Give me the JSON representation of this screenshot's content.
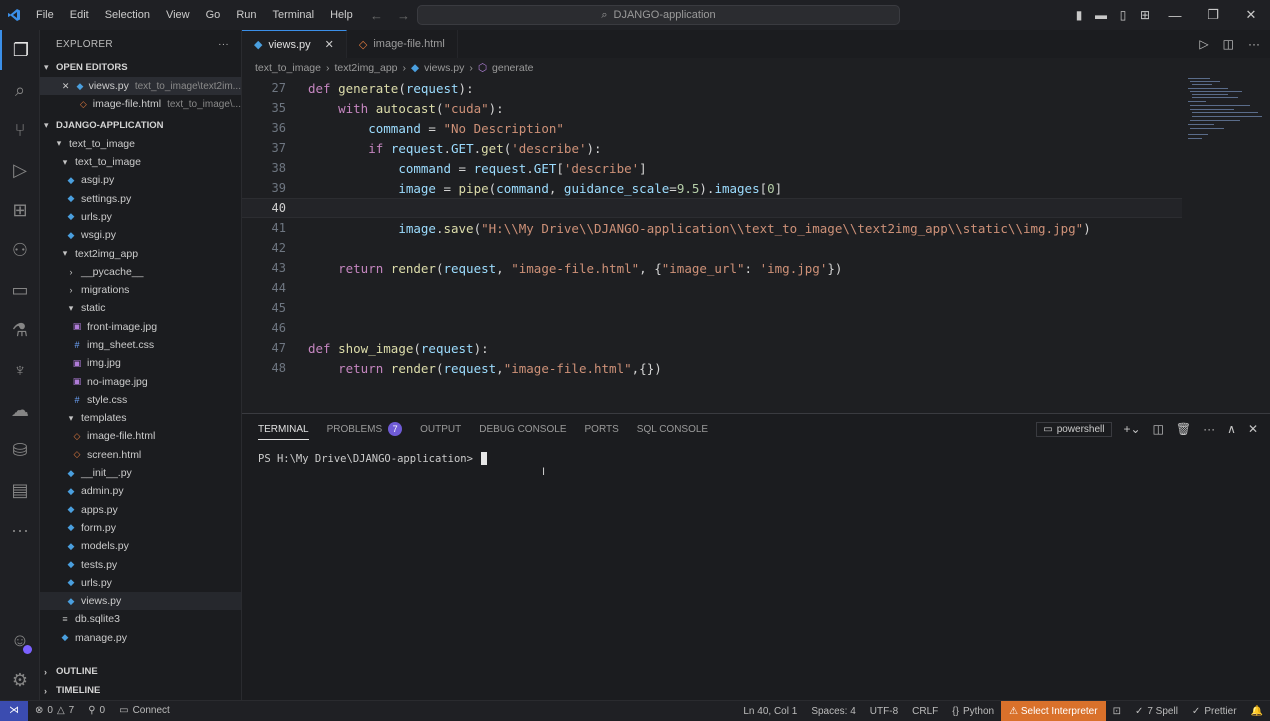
{
  "menu": [
    "File",
    "Edit",
    "Selection",
    "View",
    "Go",
    "Run",
    "Terminal",
    "Help"
  ],
  "search": {
    "text": "DJANGO-application"
  },
  "sidebar": {
    "title": "EXPLORER",
    "open_editors_label": "OPEN EDITORS",
    "open_editors": [
      {
        "name": "views.py",
        "path": "text_to_image\\text2im..."
      },
      {
        "name": "image-file.html",
        "path": "text_to_image\\..."
      }
    ],
    "project_label": "DJANGO-APPLICATION",
    "tree": [
      "text_to_image",
      "text_to_image",
      "asgi.py",
      "settings.py",
      "urls.py",
      "wsgi.py",
      "text2img_app",
      "__pycache__",
      "migrations",
      "static",
      "front-image.jpg",
      "img_sheet.css",
      "img.jpg",
      "no-image.jpg",
      "style.css",
      "templates",
      "image-file.html",
      "screen.html",
      "__init__.py",
      "admin.py",
      "apps.py",
      "form.py",
      "models.py",
      "tests.py",
      "urls.py",
      "views.py",
      "db.sqlite3",
      "manage.py"
    ],
    "outline_label": "OUTLINE",
    "timeline_label": "TIMELINE"
  },
  "tabs": [
    {
      "label": "views.py"
    },
    {
      "label": "image-file.html"
    }
  ],
  "breadcrumb": [
    "text_to_image",
    "text2img_app",
    "views.py",
    "generate"
  ],
  "editor": {
    "line_numbers": [
      "27",
      "35",
      "36",
      "37",
      "38",
      "39",
      "40",
      "41",
      "42",
      "43",
      "44",
      "45",
      "46",
      "47",
      "48"
    ]
  },
  "panel": {
    "tabs": [
      "TERMINAL",
      "PROBLEMS",
      "OUTPUT",
      "DEBUG CONSOLE",
      "PORTS",
      "SQL CONSOLE"
    ],
    "problems_count": "7",
    "shell": "powershell",
    "prompt": "PS H:\\My Drive\\DJANGO-application>"
  },
  "status": {
    "errors": "0",
    "warnings": "7",
    "ports": "0",
    "connect": "Connect",
    "position": "Ln 40, Col 1",
    "spaces": "Spaces: 4",
    "encoding": "UTF-8",
    "eol": "CRLF",
    "language": "Python",
    "interpreter": "Select Interpreter",
    "spell": "7 Spell",
    "prettier": "Prettier"
  }
}
